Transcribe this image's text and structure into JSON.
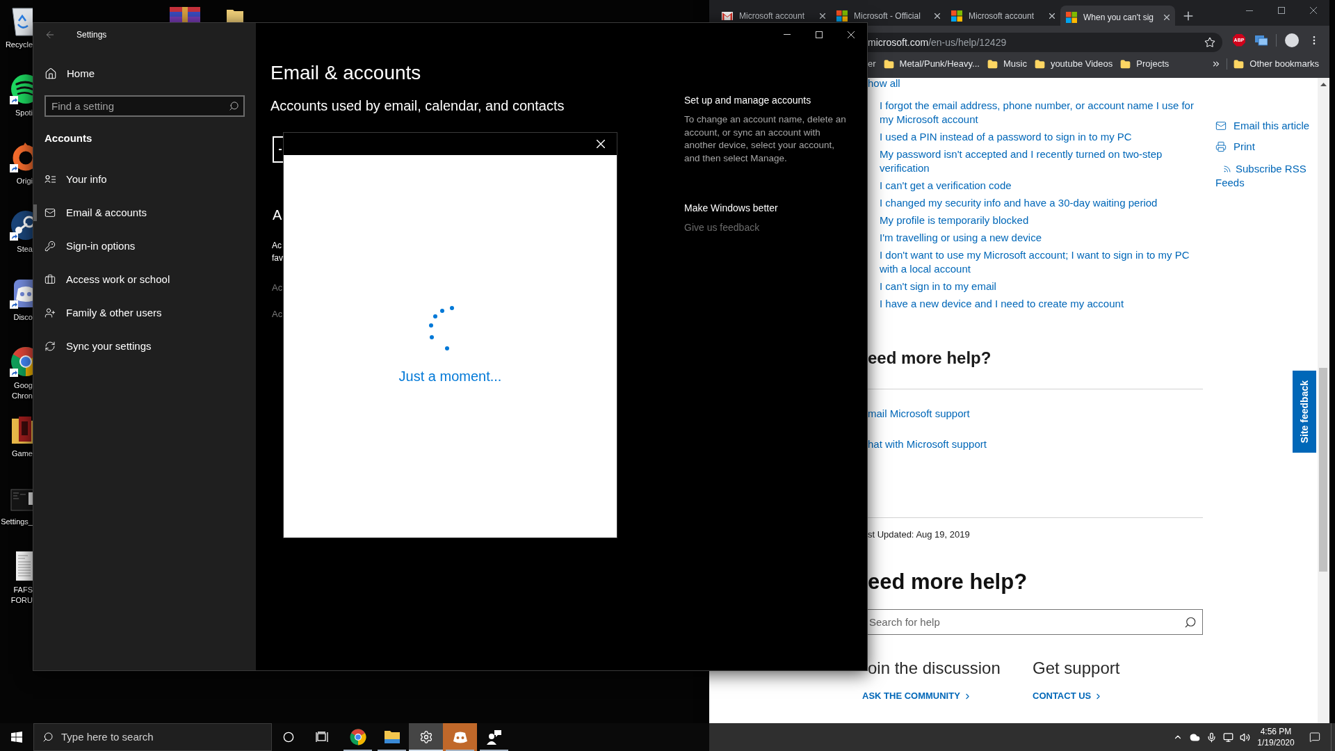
{
  "desktop": {
    "top_icons": [
      {
        "kind": "archive"
      },
      {
        "kind": "folder"
      }
    ],
    "icons": [
      {
        "kind": "recycle-bin",
        "label": "Recycle",
        "shortcut": false
      },
      {
        "kind": "music",
        "label": "Spoti",
        "shortcut": true
      },
      {
        "kind": "ring",
        "label": "Origi",
        "shortcut": true
      },
      {
        "kind": "steam",
        "label": "Stea",
        "shortcut": true
      },
      {
        "kind": "chat",
        "label": "Disco",
        "shortcut": true
      },
      {
        "kind": "browser",
        "label": "Goog Chron",
        "shortcut": true
      },
      {
        "kind": "game-folder",
        "label": "Game",
        "shortcut": false
      },
      {
        "kind": "screenshot",
        "label": "Settings_",
        "shortcut": false
      },
      {
        "kind": "document",
        "label": "FAFS FORU",
        "shortcut": false
      }
    ]
  },
  "settings_window": {
    "title": "Settings",
    "home": "Home",
    "search_placeholder": "Find a setting",
    "section": "Accounts",
    "nav": [
      {
        "kind": "info",
        "label": "Your info",
        "selected": false
      },
      {
        "kind": "mail",
        "label": "Email & accounts",
        "selected": true
      },
      {
        "kind": "key",
        "label": "Sign-in options",
        "selected": false
      },
      {
        "kind": "briefcase",
        "label": "Access work or school",
        "selected": false
      },
      {
        "kind": "family",
        "label": "Family & other users",
        "selected": false
      },
      {
        "kind": "sync",
        "label": "Sync your settings",
        "selected": false
      }
    ],
    "page_title": "Email & accounts",
    "subtitle": "Accounts used by email, calendar, and contacts",
    "covered": {
      "heading": "A",
      "paragraph": "Ac\nfav",
      "links": [
        "Ac",
        "Ac"
      ]
    },
    "aside": [
      {
        "kind": "text",
        "heading": "Set up and manage accounts",
        "text": "To change an account name, delete an account, or sync an account with another device, select your account, and then select Manage."
      },
      {
        "kind": "link",
        "heading": "Make Windows better",
        "link": "Give us feedback"
      }
    ]
  },
  "dialog": {
    "message": "Just a moment..."
  },
  "browser": {
    "tabs": [
      {
        "kind": "mail",
        "title": "Microsoft account",
        "selected": false
      },
      {
        "kind": "squares",
        "title": "Microsoft - Official",
        "selected": false
      },
      {
        "kind": "squares",
        "title": "Microsoft account",
        "selected": false
      },
      {
        "kind": "squares",
        "title": "When you can't sig",
        "selected": true
      }
    ],
    "address": {
      "host": "microsoft.com",
      "path": "/en-us/help/12429"
    },
    "extensions": [
      {
        "kind": "blocker",
        "label": "ABP"
      },
      {
        "kind": "screens"
      }
    ],
    "bookmarks": [
      {
        "kind": "plain",
        "label": "er"
      },
      {
        "kind": "folder",
        "label": "Metal/Punk/Heavy..."
      },
      {
        "kind": "folder",
        "label": "Music"
      },
      {
        "kind": "folder",
        "label": "youtube Videos"
      },
      {
        "kind": "folder",
        "label": "Projects"
      }
    ],
    "other_bookmarks": "Other bookmarks",
    "page": {
      "show_all": "how all",
      "links": [
        "I forgot the email address, phone number, or account name I use for my Microsoft account",
        "I used a PIN instead of a password to sign in to my PC",
        "My password isn't accepted and I recently turned on two-step verification",
        "I can't get a verification code",
        "I changed my security info and have a 30-day waiting period",
        "My profile is temporarily blocked",
        "I'm travelling or using a new device",
        "I don't want to use my Microsoft account; I want to sign in to my PC with a local account",
        "I can't sign in to my email",
        "I have a new device and I need to create my account"
      ],
      "actions": [
        {
          "kind": "mail",
          "label": "Email this article"
        },
        {
          "kind": "print",
          "label": "Print"
        },
        {
          "kind": "rss",
          "label": "Subscribe RSS Feeds"
        }
      ],
      "help_heading": "eed more help?",
      "support_links": [
        "mail Microsoft support",
        "hat with Microsoft support"
      ],
      "last_updated": "st Updated: Aug 19, 2019",
      "search_heading": "eed more help?",
      "search_placeholder": "Search for help",
      "columns": [
        {
          "heading": "oin the discussion",
          "link": "ASK THE COMMUNITY"
        },
        {
          "heading": "Get support",
          "link": "CONTACT US"
        }
      ],
      "feedback_tab": "Site feedback"
    }
  },
  "taskbar": {
    "search_placeholder": "Type here to search",
    "apps": [
      {
        "kind": "browser",
        "open": true,
        "selected": false,
        "alert": false
      },
      {
        "kind": "files",
        "open": true,
        "selected": false,
        "alert": false
      },
      {
        "kind": "settings",
        "open": true,
        "selected": true,
        "alert": false
      },
      {
        "kind": "chat",
        "open": true,
        "selected": false,
        "alert": true
      },
      {
        "kind": "people",
        "open": true,
        "selected": false,
        "alert": false
      }
    ],
    "time": "4:56 PM",
    "date": "1/19/2020"
  }
}
